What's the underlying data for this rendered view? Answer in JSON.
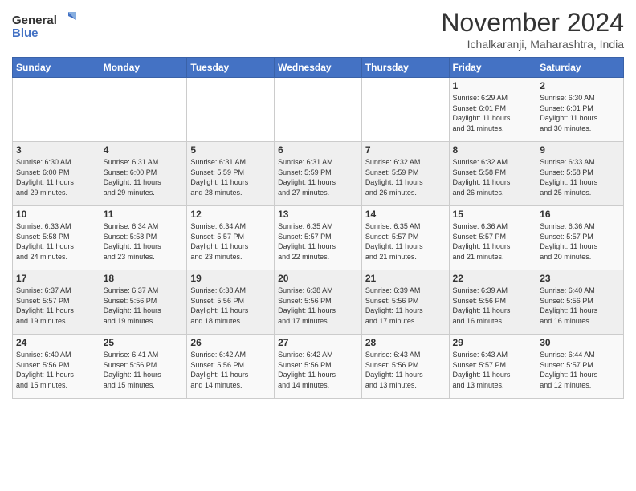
{
  "logo": {
    "line1": "General",
    "line2": "Blue"
  },
  "title": "November 2024",
  "location": "Ichalkaranji, Maharashtra, India",
  "weekdays": [
    "Sunday",
    "Monday",
    "Tuesday",
    "Wednesday",
    "Thursday",
    "Friday",
    "Saturday"
  ],
  "weeks": [
    [
      {
        "day": "",
        "info": ""
      },
      {
        "day": "",
        "info": ""
      },
      {
        "day": "",
        "info": ""
      },
      {
        "day": "",
        "info": ""
      },
      {
        "day": "",
        "info": ""
      },
      {
        "day": "1",
        "info": "Sunrise: 6:29 AM\nSunset: 6:01 PM\nDaylight: 11 hours\nand 31 minutes."
      },
      {
        "day": "2",
        "info": "Sunrise: 6:30 AM\nSunset: 6:01 PM\nDaylight: 11 hours\nand 30 minutes."
      }
    ],
    [
      {
        "day": "3",
        "info": "Sunrise: 6:30 AM\nSunset: 6:00 PM\nDaylight: 11 hours\nand 29 minutes."
      },
      {
        "day": "4",
        "info": "Sunrise: 6:31 AM\nSunset: 6:00 PM\nDaylight: 11 hours\nand 29 minutes."
      },
      {
        "day": "5",
        "info": "Sunrise: 6:31 AM\nSunset: 5:59 PM\nDaylight: 11 hours\nand 28 minutes."
      },
      {
        "day": "6",
        "info": "Sunrise: 6:31 AM\nSunset: 5:59 PM\nDaylight: 11 hours\nand 27 minutes."
      },
      {
        "day": "7",
        "info": "Sunrise: 6:32 AM\nSunset: 5:59 PM\nDaylight: 11 hours\nand 26 minutes."
      },
      {
        "day": "8",
        "info": "Sunrise: 6:32 AM\nSunset: 5:58 PM\nDaylight: 11 hours\nand 26 minutes."
      },
      {
        "day": "9",
        "info": "Sunrise: 6:33 AM\nSunset: 5:58 PM\nDaylight: 11 hours\nand 25 minutes."
      }
    ],
    [
      {
        "day": "10",
        "info": "Sunrise: 6:33 AM\nSunset: 5:58 PM\nDaylight: 11 hours\nand 24 minutes."
      },
      {
        "day": "11",
        "info": "Sunrise: 6:34 AM\nSunset: 5:58 PM\nDaylight: 11 hours\nand 23 minutes."
      },
      {
        "day": "12",
        "info": "Sunrise: 6:34 AM\nSunset: 5:57 PM\nDaylight: 11 hours\nand 23 minutes."
      },
      {
        "day": "13",
        "info": "Sunrise: 6:35 AM\nSunset: 5:57 PM\nDaylight: 11 hours\nand 22 minutes."
      },
      {
        "day": "14",
        "info": "Sunrise: 6:35 AM\nSunset: 5:57 PM\nDaylight: 11 hours\nand 21 minutes."
      },
      {
        "day": "15",
        "info": "Sunrise: 6:36 AM\nSunset: 5:57 PM\nDaylight: 11 hours\nand 21 minutes."
      },
      {
        "day": "16",
        "info": "Sunrise: 6:36 AM\nSunset: 5:57 PM\nDaylight: 11 hours\nand 20 minutes."
      }
    ],
    [
      {
        "day": "17",
        "info": "Sunrise: 6:37 AM\nSunset: 5:57 PM\nDaylight: 11 hours\nand 19 minutes."
      },
      {
        "day": "18",
        "info": "Sunrise: 6:37 AM\nSunset: 5:56 PM\nDaylight: 11 hours\nand 19 minutes."
      },
      {
        "day": "19",
        "info": "Sunrise: 6:38 AM\nSunset: 5:56 PM\nDaylight: 11 hours\nand 18 minutes."
      },
      {
        "day": "20",
        "info": "Sunrise: 6:38 AM\nSunset: 5:56 PM\nDaylight: 11 hours\nand 17 minutes."
      },
      {
        "day": "21",
        "info": "Sunrise: 6:39 AM\nSunset: 5:56 PM\nDaylight: 11 hours\nand 17 minutes."
      },
      {
        "day": "22",
        "info": "Sunrise: 6:39 AM\nSunset: 5:56 PM\nDaylight: 11 hours\nand 16 minutes."
      },
      {
        "day": "23",
        "info": "Sunrise: 6:40 AM\nSunset: 5:56 PM\nDaylight: 11 hours\nand 16 minutes."
      }
    ],
    [
      {
        "day": "24",
        "info": "Sunrise: 6:40 AM\nSunset: 5:56 PM\nDaylight: 11 hours\nand 15 minutes."
      },
      {
        "day": "25",
        "info": "Sunrise: 6:41 AM\nSunset: 5:56 PM\nDaylight: 11 hours\nand 15 minutes."
      },
      {
        "day": "26",
        "info": "Sunrise: 6:42 AM\nSunset: 5:56 PM\nDaylight: 11 hours\nand 14 minutes."
      },
      {
        "day": "27",
        "info": "Sunrise: 6:42 AM\nSunset: 5:56 PM\nDaylight: 11 hours\nand 14 minutes."
      },
      {
        "day": "28",
        "info": "Sunrise: 6:43 AM\nSunset: 5:56 PM\nDaylight: 11 hours\nand 13 minutes."
      },
      {
        "day": "29",
        "info": "Sunrise: 6:43 AM\nSunset: 5:57 PM\nDaylight: 11 hours\nand 13 minutes."
      },
      {
        "day": "30",
        "info": "Sunrise: 6:44 AM\nSunset: 5:57 PM\nDaylight: 11 hours\nand 12 minutes."
      }
    ]
  ]
}
